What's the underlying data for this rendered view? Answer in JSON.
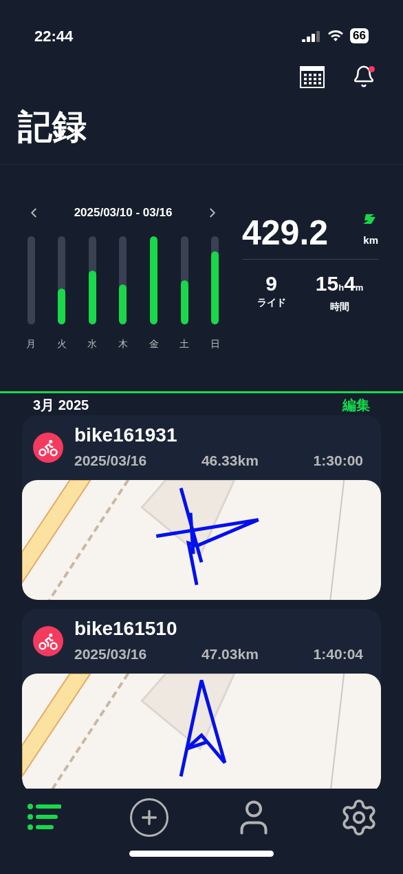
{
  "status_bar": {
    "time": "22:44",
    "battery": "66"
  },
  "header": {
    "title": "記録",
    "notification_unread": true
  },
  "week": {
    "range": "2025/03/10 - 03/16",
    "days": [
      {
        "label": "月",
        "level": 0
      },
      {
        "label": "火",
        "level": 0.41
      },
      {
        "label": "水",
        "level": 0.61
      },
      {
        "label": "木",
        "level": 0.45
      },
      {
        "label": "金",
        "level": 1
      },
      {
        "label": "土",
        "level": 0.5
      },
      {
        "label": "日",
        "level": 0.83
      }
    ],
    "distance": "429.2",
    "distance_unit": "km",
    "rides": "9",
    "rides_label": "ライド",
    "hours": "15",
    "hours_unit": "h",
    "minutes": "4",
    "minutes_unit": "m",
    "time_label": "時間"
  },
  "month": {
    "title": "3月 2025",
    "edit": "編集"
  },
  "rides": [
    {
      "name": "bike161931",
      "date": "2025/03/16",
      "distance": "46.33km",
      "duration": "1:30:00"
    },
    {
      "name": "bike161510",
      "date": "2025/03/16",
      "distance": "47.03km",
      "duration": "1:40:04"
    }
  ],
  "tabs": [
    {
      "kind": "list",
      "selected": true
    },
    {
      "kind": "add",
      "selected": false
    },
    {
      "kind": "profile",
      "selected": false
    },
    {
      "kind": "settings",
      "selected": false
    }
  ]
}
